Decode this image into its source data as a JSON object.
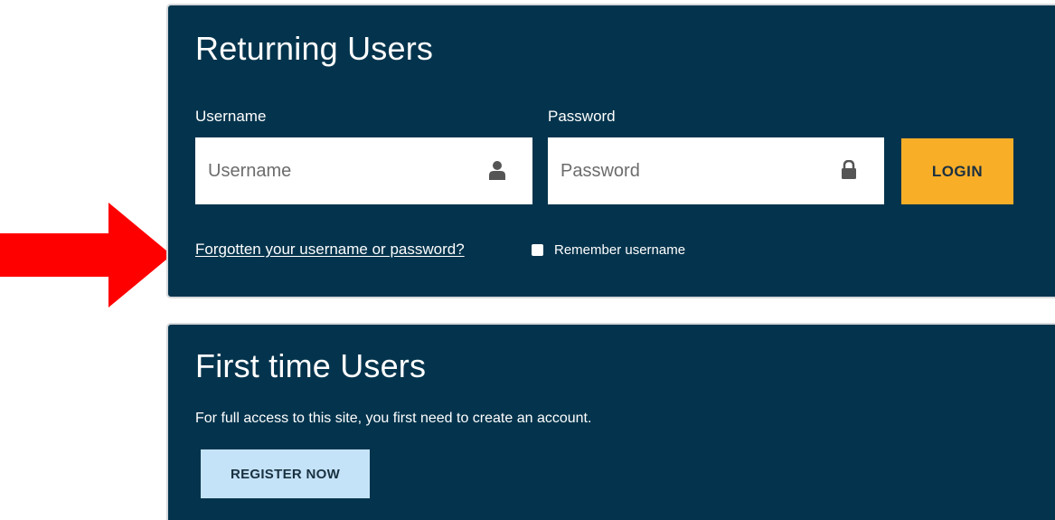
{
  "returning": {
    "title": "Returning Users",
    "username": {
      "label": "Username",
      "placeholder": "Username",
      "value": "",
      "icon": "user-icon"
    },
    "password": {
      "label": "Password",
      "placeholder": "Password",
      "value": "",
      "icon": "lock-icon"
    },
    "login_label": "LOGIN",
    "forgot_link": "Forgotten your username or password?",
    "remember_label": "Remember username",
    "remember_checked": false
  },
  "first_time": {
    "title": "First time Users",
    "intro": "For full access to this site, you first need to create an account.",
    "register_label": "REGISTER NOW"
  },
  "annotation": {
    "icon": "arrow-right-icon"
  },
  "colors": {
    "panel_bg": "#04344d",
    "login_button": "#f9ae28",
    "register_button": "#c5e3f8",
    "annotation_arrow": "#ff0000"
  }
}
